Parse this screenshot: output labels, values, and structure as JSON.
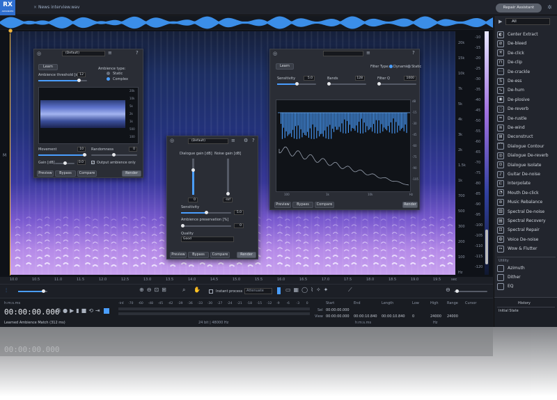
{
  "app": {
    "logo": "RX",
    "logo_sub": "ADVANCED",
    "tab_title": "News interview.wav",
    "repair_assistant": "Repair Assistant"
  },
  "freq_labels": [
    "20k",
    "15k",
    "10k",
    "7k",
    "5k",
    "4k",
    "3k",
    "2k",
    "1.5k",
    "1k",
    "700",
    "500",
    "300",
    "200",
    "100",
    "Hz"
  ],
  "db_labels": [
    "-10",
    "-15",
    "-20",
    "-25",
    "-30",
    "-35",
    "-40",
    "-45",
    "-50",
    "-55",
    "-60",
    "-65",
    "-70",
    "-75",
    "-80",
    "-85",
    "-90",
    "-95",
    "-100",
    "-105",
    "-110",
    "-115",
    "-120"
  ],
  "timeline": [
    "10.0",
    "10.5",
    "11.0",
    "11.5",
    "12.0",
    "12.5",
    "13.0",
    "13.5",
    "14.0",
    "14.5",
    "15.0",
    "15.5",
    "16.0",
    "16.5",
    "17.0",
    "17.5",
    "18.0",
    "18.5",
    "19.0",
    "19.5"
  ],
  "timeline_unit": "sec",
  "ambience_window": {
    "preset": "(Default)",
    "learn": "Learn",
    "threshold_label": "Ambience threshold [dB]",
    "threshold_value": "12",
    "type_label": "Ambience type:",
    "type_static": "Static",
    "type_complex": "Complex",
    "movement_label": "Movement",
    "movement_value": "10",
    "randomness_label": "Randomness",
    "randomness_value": "0",
    "gain_label": "Gain [dB]",
    "gain_value": "0.0",
    "output_only": "Output ambience only",
    "preview": "Preview",
    "bypass": "Bypass",
    "compare": "Compare",
    "render": "Render",
    "graph_labels": [
      "20k",
      "10k",
      "5k",
      "2k",
      "1k",
      "500",
      "100"
    ]
  },
  "dialogue_window": {
    "preset": "(Default)",
    "dialogue_gain": "Dialogue gain [dB]",
    "dialogue_value": "0",
    "noise_gain": "Noise gain [dB]",
    "noise_value": "-Inf",
    "sensitivity": "Sensitivity",
    "sensitivity_value": "5.0",
    "ambience_pres": "Ambience preservation [%]",
    "ambience_pres_value": "0",
    "quality": "Quality",
    "quality_value": "Good",
    "preview": "Preview",
    "bypass": "Bypass",
    "compare": "Compare",
    "render": "Render"
  },
  "spectral_window": {
    "learn": "Learn",
    "filter_type": "Filter Type:",
    "dynamic": "Dynamic",
    "static": "Static",
    "sensitivity": "Sensitivity",
    "sensitivity_value": "5.0",
    "bands": "Bands",
    "bands_value": "128",
    "filter_q": "Filter Q",
    "filter_q_value": "1000",
    "x_labels": [
      "100",
      "1k",
      "10k",
      "Hz"
    ],
    "y_labels": [
      "dB",
      "-15",
      "-30",
      "-45",
      "-60",
      "-75",
      "-90",
      "-105"
    ],
    "preview": "Preview",
    "bypass": "Bypass",
    "compare": "Compare",
    "render": "Render"
  },
  "tools": {
    "instant_process": "Instant process",
    "attenuate": "Attenuate"
  },
  "status": {
    "format": "h:m:s.ms",
    "time": "00:00:00.000",
    "message": "Learned Ambience Match (312 ms)",
    "meter_labels": [
      "-Inf.",
      "-70",
      "-60",
      "-48",
      "-45",
      "-42",
      "-39",
      "-36",
      "-33",
      "-30",
      "-27",
      "-24",
      "-21",
      "-18",
      "-15",
      "-12",
      "-9",
      "-6",
      "-3",
      "0"
    ],
    "bit": "24 bit | 48000 Hz",
    "headers": [
      "Start",
      "End",
      "Length",
      "Low",
      "High",
      "Range",
      "Cursor"
    ],
    "sel_label": "Sel",
    "view_label": "View",
    "sel": [
      "00:00:00.000",
      "",
      "",
      "",
      "",
      "",
      ""
    ],
    "view": [
      "00:00:00.000",
      "00:00:10.840",
      "00:00:10.840",
      "0",
      "24000",
      "24000",
      ""
    ],
    "hms": "h:m:s.ms",
    "hz": "Hz"
  },
  "sidebar": {
    "filter": "All",
    "items": [
      "Center Extract",
      "De-bleed",
      "De-click",
      "De-clip",
      "De-crackle",
      "De-ess",
      "De-hum",
      "De-plosive",
      "De-reverb",
      "De-rustle",
      "De-wind",
      "Deconstruct",
      "Dialogue Contour",
      "Dialogue De-reverb",
      "Dialogue Isolate",
      "Guitar De-noise",
      "Interpolate",
      "Mouth De-click",
      "Music Rebalance",
      "Spectral De-noise",
      "Spectral Recovery",
      "Spectral Repair",
      "Voice De-noise",
      "Wow & Flutter"
    ],
    "utility": "Utility",
    "utility_items": [
      "Azimuth",
      "Dither",
      "EQ"
    ],
    "history": "History",
    "history_item": "Initial State"
  },
  "colors": {
    "accent": "#4a9eff",
    "spectrum_top": "#1d2f63",
    "spectrum_bottom": "#c8a2ef"
  }
}
